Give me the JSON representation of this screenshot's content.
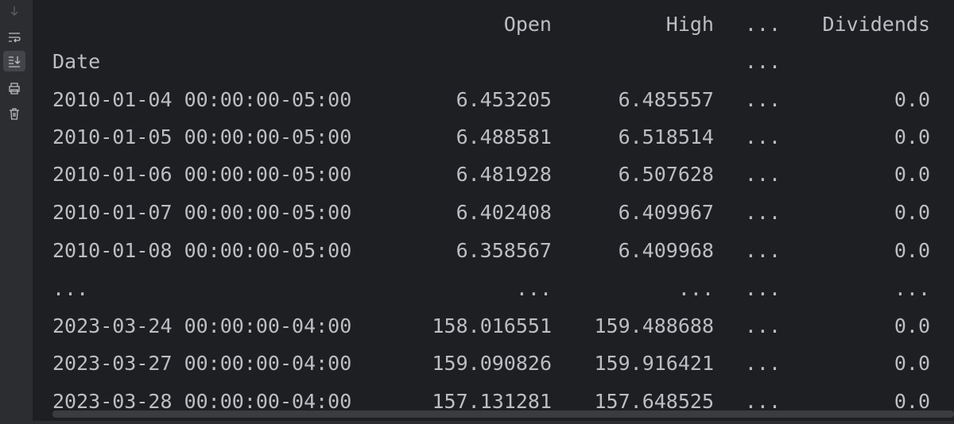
{
  "toolbar": {
    "buttons": [
      {
        "name": "scroll-down-icon",
        "active": false
      },
      {
        "name": "soft-wrap-icon",
        "active": false
      },
      {
        "name": "scroll-to-end-icon",
        "active": true
      },
      {
        "name": "print-icon",
        "active": false
      },
      {
        "name": "trash-icon",
        "active": false
      }
    ]
  },
  "output": {
    "header": {
      "open": "Open",
      "high": "High",
      "ellipsis": "...",
      "dividends": "Dividends"
    },
    "index_label": {
      "date": "Date",
      "ellipsis": "..."
    },
    "rows": [
      {
        "date": "2010-01-04 00:00:00-05:00",
        "open": "6.453205",
        "high": "6.485557",
        "ellipsis": "...",
        "dividends": "0.0"
      },
      {
        "date": "2010-01-05 00:00:00-05:00",
        "open": "6.488581",
        "high": "6.518514",
        "ellipsis": "...",
        "dividends": "0.0"
      },
      {
        "date": "2010-01-06 00:00:00-05:00",
        "open": "6.481928",
        "high": "6.507628",
        "ellipsis": "...",
        "dividends": "0.0"
      },
      {
        "date": "2010-01-07 00:00:00-05:00",
        "open": "6.402408",
        "high": "6.409967",
        "ellipsis": "...",
        "dividends": "0.0"
      },
      {
        "date": "2010-01-08 00:00:00-05:00",
        "open": "6.358567",
        "high": "6.409968",
        "ellipsis": "...",
        "dividends": "0.0"
      },
      {
        "date": "...",
        "open": "...",
        "high": "...",
        "ellipsis": "...",
        "dividends": "..."
      },
      {
        "date": "2023-03-24 00:00:00-04:00",
        "open": "158.016551",
        "high": "159.488688",
        "ellipsis": "...",
        "dividends": "0.0"
      },
      {
        "date": "2023-03-27 00:00:00-04:00",
        "open": "159.090826",
        "high": "159.916421",
        "ellipsis": "...",
        "dividends": "0.0"
      },
      {
        "date": "2023-03-28 00:00:00-04:00",
        "open": "157.131281",
        "high": "157.648525",
        "ellipsis": "...",
        "dividends": "0.0"
      }
    ]
  }
}
